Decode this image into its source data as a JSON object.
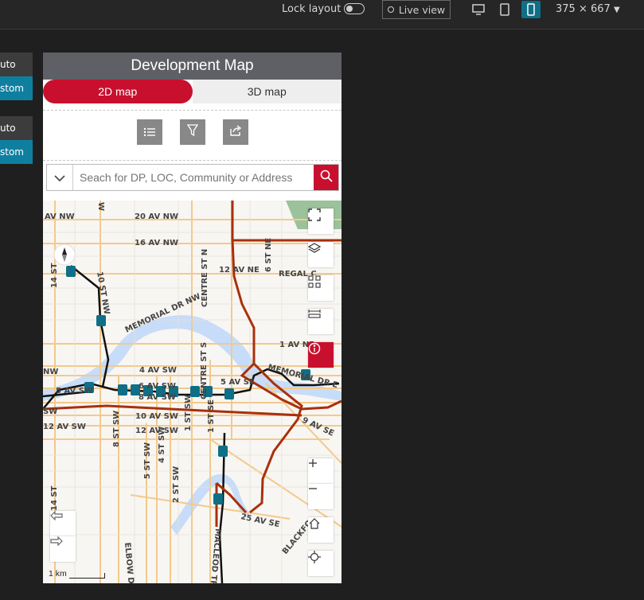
{
  "topbar": {
    "lock_label": "Lock layout",
    "live_view_label": "Live view",
    "size_label": "375 × 667"
  },
  "side_tabs": [
    "uto",
    "stom",
    "uto",
    "stom"
  ],
  "app": {
    "title": "Development Map",
    "tabs": [
      {
        "label": "2D map",
        "active": true
      },
      {
        "label": "3D map",
        "active": false
      }
    ],
    "toolbar": [
      "list-icon",
      "filter-icon",
      "share-icon"
    ],
    "search_placeholder": "Seach for DP, LOC, Community or Address"
  },
  "map": {
    "labels": {
      "av_nw": "AV NW",
      "ave20": "20 AV NW",
      "ave16": "16 AV NW",
      "ave12ne": "12 AV NE",
      "st6ne": "6 ST NE",
      "regal": "REGAL C",
      "memorial": "MEMORIAL DR NW",
      "centre_n": "CENTRE ST N",
      "ave1ne": "1 AV NE",
      "memorial_e": "MEMORIAL DR E",
      "ave4sw": "4 AV SW",
      "ave5se": "5 AV SE",
      "ave6sw": "6 AV SW",
      "ave8sw": "8 AV SW",
      "ave10sw": "10 AV SW",
      "ave12sw": "12 AV SW",
      "ave12sw2": "12 AV SW",
      "ave9se": "9 AV SE",
      "ave25se": "25 AV SE",
      "st14": "14 ST",
      "st14b": "14 ST",
      "nw10": "10 ST NW",
      "st8sw": "8 ST SW",
      "st5sw": "5 ST SW",
      "st4sw": "4 ST SW",
      "st2sw": "2 ST SW",
      "st1sw": "1 ST SW",
      "st1se": "1 ST SE",
      "centre_s": "CENTRE ST S",
      "elbow": "ELBOW DR",
      "macleod": "MACLEOD TR S",
      "blackfoot": "BLACKFO",
      "nw_w": "NW",
      "sw_w": "SW",
      "w_top": "W",
      "ave5sw": "5 AV SW"
    },
    "scale_label": "1 km",
    "controls": [
      "fullscreen-icon",
      "layers-icon",
      "qr-icon",
      "measure-icon",
      "info-icon",
      "zoom-in-icon",
      "zoom-out-icon",
      "home-icon",
      "locate-icon"
    ],
    "nav": [
      "back-arrow-icon",
      "forward-arrow-icon"
    ]
  },
  "colors": {
    "accent": "#c8102e",
    "header": "#5f6066",
    "teal": "#0f6f86",
    "river": "#c6daf7",
    "route": "#a0300c",
    "road": "#f3c98d"
  }
}
